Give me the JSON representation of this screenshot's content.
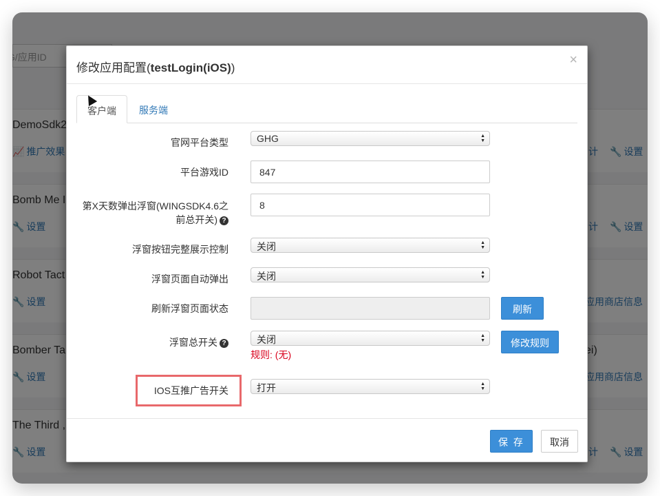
{
  "background": {
    "search_placeholder": "G/应用ID",
    "apps": [
      {
        "name": "DemoSdk2",
        "left_link": "推广效果",
        "right_link_a": "计",
        "right_link_b": "设置",
        "left_icon": "chart-icon",
        "right_icon": "wrench-icon"
      },
      {
        "name": "Bomb Me I",
        "left_link": "设置",
        "right_link_a": "计",
        "right_link_b": "设置",
        "left_icon": "wrench-icon",
        "right_icon": "wrench-icon"
      },
      {
        "name": "Robot Tact",
        "left_link": "设置",
        "right_link_a": "应用商店信息",
        "right_link_b": "",
        "left_icon": "wrench-icon",
        "right_icon": ""
      },
      {
        "name": "Bomber Ta",
        "left_link": "设置",
        "right_link_a": "应用商店信息",
        "right_link_b": "",
        "extra": "ei)",
        "left_icon": "wrench-icon",
        "right_icon": ""
      },
      {
        "name": "The Third ,",
        "left_link": "设置",
        "right_link_a": "计",
        "right_link_b": "设置",
        "left_icon": "wrench-icon",
        "right_icon": "wrench-icon"
      }
    ]
  },
  "modal": {
    "title_prefix": "修改应用配置(",
    "title_bold": "testLogin(iOS)",
    "title_suffix": ")",
    "close": "×",
    "tabs": [
      {
        "label": "客户端",
        "active": true
      },
      {
        "label": "服务端",
        "active": false
      }
    ],
    "fields": {
      "platform_type": {
        "label": "官网平台类型",
        "value": "GHG"
      },
      "game_id": {
        "label": "平台游戏ID",
        "value": "847"
      },
      "popup_day": {
        "label_line1": "第X天数弹出浮窗(WINGSDK4.6之",
        "label_line2": "前总开关)",
        "value": "8",
        "help_icon": "question-circle-icon"
      },
      "float_full_display": {
        "label": "浮窗按钮完整展示控制",
        "value": "关闭"
      },
      "float_auto_popup": {
        "label": "浮窗页面自动弹出",
        "value": "关闭"
      },
      "refresh_status": {
        "label": "刷新浮窗页面状态",
        "value": "",
        "button": "刷新"
      },
      "float_master": {
        "label": "浮窗总开关",
        "value": "关闭",
        "button": "修改规则",
        "rule": "规则: (无)",
        "help_icon": "question-circle-icon"
      },
      "ios_cross_promo": {
        "label": "IOS互推广告开关",
        "value": "打开"
      }
    },
    "footer": {
      "save": "保 存",
      "cancel": "取消"
    }
  },
  "colors": {
    "primary": "#3c8fd9",
    "rule_red": "#d9001b",
    "highlight": "#e8686b",
    "link": "#337ab7"
  }
}
